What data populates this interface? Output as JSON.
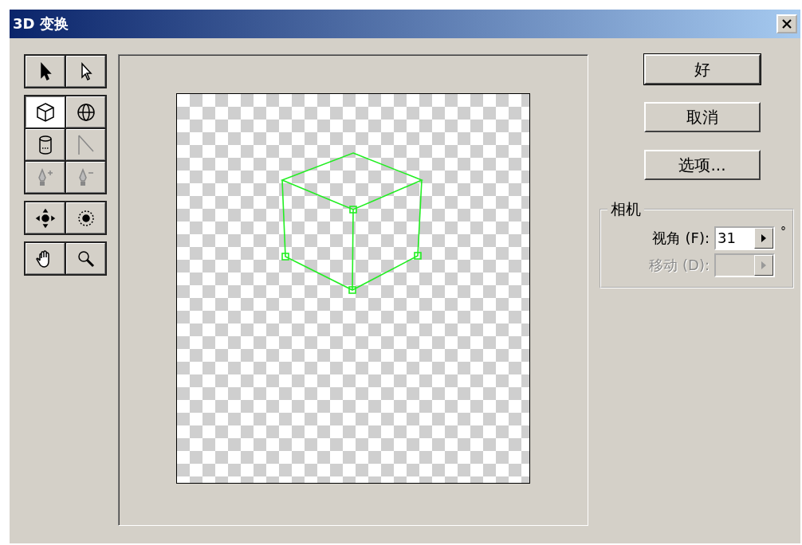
{
  "window": {
    "title": "3D 变换"
  },
  "tool_groups": [
    {
      "tools": [
        {
          "kind": "pointer",
          "selected": false,
          "disabled": false
        },
        {
          "kind": "direct-pointer",
          "selected": false,
          "disabled": false
        }
      ]
    },
    {
      "tools": [
        {
          "kind": "cube",
          "selected": true,
          "disabled": false
        },
        {
          "kind": "sphere",
          "selected": false,
          "disabled": false
        },
        {
          "kind": "cylinder",
          "selected": false,
          "disabled": false
        },
        {
          "kind": "convert-point",
          "selected": false,
          "disabled": true
        },
        {
          "kind": "add-anchor",
          "selected": false,
          "disabled": true
        },
        {
          "kind": "delete-anchor",
          "selected": false,
          "disabled": true
        }
      ]
    },
    {
      "tools": [
        {
          "kind": "pan-camera",
          "selected": false,
          "disabled": false
        },
        {
          "kind": "trackball",
          "selected": false,
          "disabled": false
        }
      ]
    },
    {
      "tools": [
        {
          "kind": "hand",
          "selected": false,
          "disabled": false
        },
        {
          "kind": "zoom",
          "selected": false,
          "disabled": false
        }
      ]
    }
  ],
  "buttons": [
    {
      "label": "好",
      "default": true
    },
    {
      "label": "取消",
      "default": false
    },
    {
      "label": "选项...",
      "default": false
    }
  ],
  "camera": {
    "legend": "相机",
    "fields": [
      {
        "label": "视角 (F):",
        "value": "31",
        "unit": "°",
        "disabled": false
      },
      {
        "label": "移动 (D):",
        "disabled": true
      }
    ]
  }
}
